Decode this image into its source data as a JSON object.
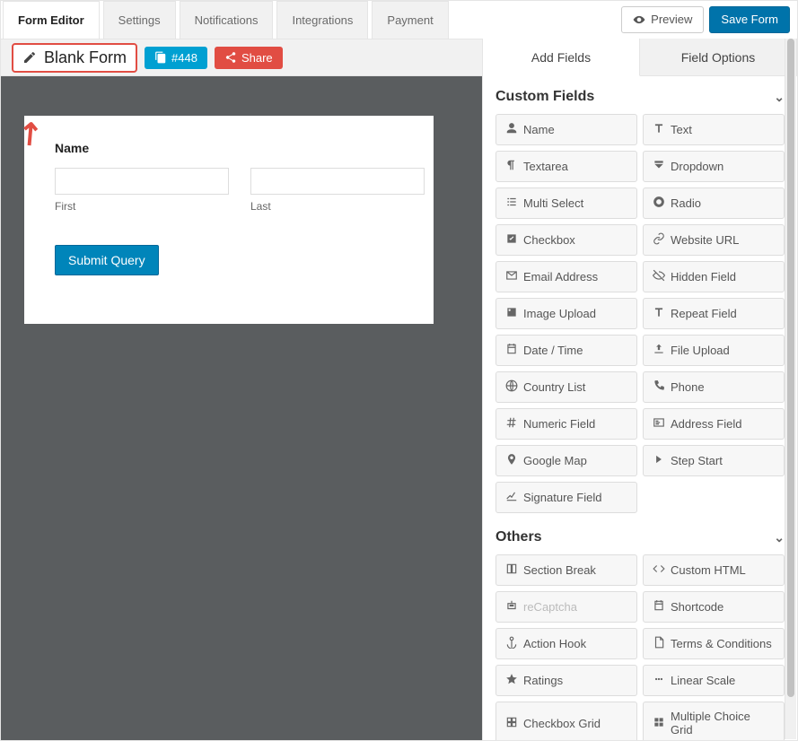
{
  "topTabs": [
    "Form Editor",
    "Settings",
    "Notifications",
    "Integrations",
    "Payment"
  ],
  "actions": {
    "preview": "Preview",
    "save": "Save Form"
  },
  "formName": "Blank Form",
  "idBadge": "#448",
  "shareLabel": "Share",
  "panelTabs": {
    "addFields": "Add Fields",
    "fieldOptions": "Field Options"
  },
  "canvas": {
    "nameLabel": "Name",
    "firstLabel": "First",
    "lastLabel": "Last",
    "submit": "Submit Query"
  },
  "sections": {
    "custom": {
      "title": "Custom Fields",
      "items": [
        {
          "icon": "user",
          "label": "Name"
        },
        {
          "icon": "text",
          "label": "Text"
        },
        {
          "icon": "para",
          "label": "Textarea"
        },
        {
          "icon": "dropdown",
          "label": "Dropdown"
        },
        {
          "icon": "list",
          "label": "Multi Select"
        },
        {
          "icon": "radio",
          "label": "Radio"
        },
        {
          "icon": "check",
          "label": "Checkbox"
        },
        {
          "icon": "link",
          "label": "Website URL"
        },
        {
          "icon": "mail",
          "label": "Email Address"
        },
        {
          "icon": "eyeoff",
          "label": "Hidden Field"
        },
        {
          "icon": "img",
          "label": "Image Upload"
        },
        {
          "icon": "text",
          "label": "Repeat Field"
        },
        {
          "icon": "cal",
          "label": "Date / Time"
        },
        {
          "icon": "upload",
          "label": "File Upload"
        },
        {
          "icon": "globe",
          "label": "Country List"
        },
        {
          "icon": "phone",
          "label": "Phone"
        },
        {
          "icon": "hash",
          "label": "Numeric Field"
        },
        {
          "icon": "card",
          "label": "Address Field"
        },
        {
          "icon": "pin",
          "label": "Google Map"
        },
        {
          "icon": "step",
          "label": "Step Start"
        },
        {
          "icon": "sig",
          "label": "Signature Field"
        }
      ]
    },
    "others": {
      "title": "Others",
      "items": [
        {
          "icon": "cols",
          "label": "Section Break"
        },
        {
          "icon": "code",
          "label": "Custom HTML"
        },
        {
          "icon": "robot",
          "label": "reCaptcha",
          "disabled": true
        },
        {
          "icon": "cal",
          "label": "Shortcode"
        },
        {
          "icon": "anchor",
          "label": "Action Hook"
        },
        {
          "icon": "file",
          "label": "Terms & Conditions"
        },
        {
          "icon": "star",
          "label": "Ratings"
        },
        {
          "icon": "ellips",
          "label": "Linear Scale"
        },
        {
          "icon": "grid",
          "label": "Checkbox Grid"
        },
        {
          "icon": "grid2",
          "label": "Multiple Choice Grid"
        }
      ]
    }
  }
}
